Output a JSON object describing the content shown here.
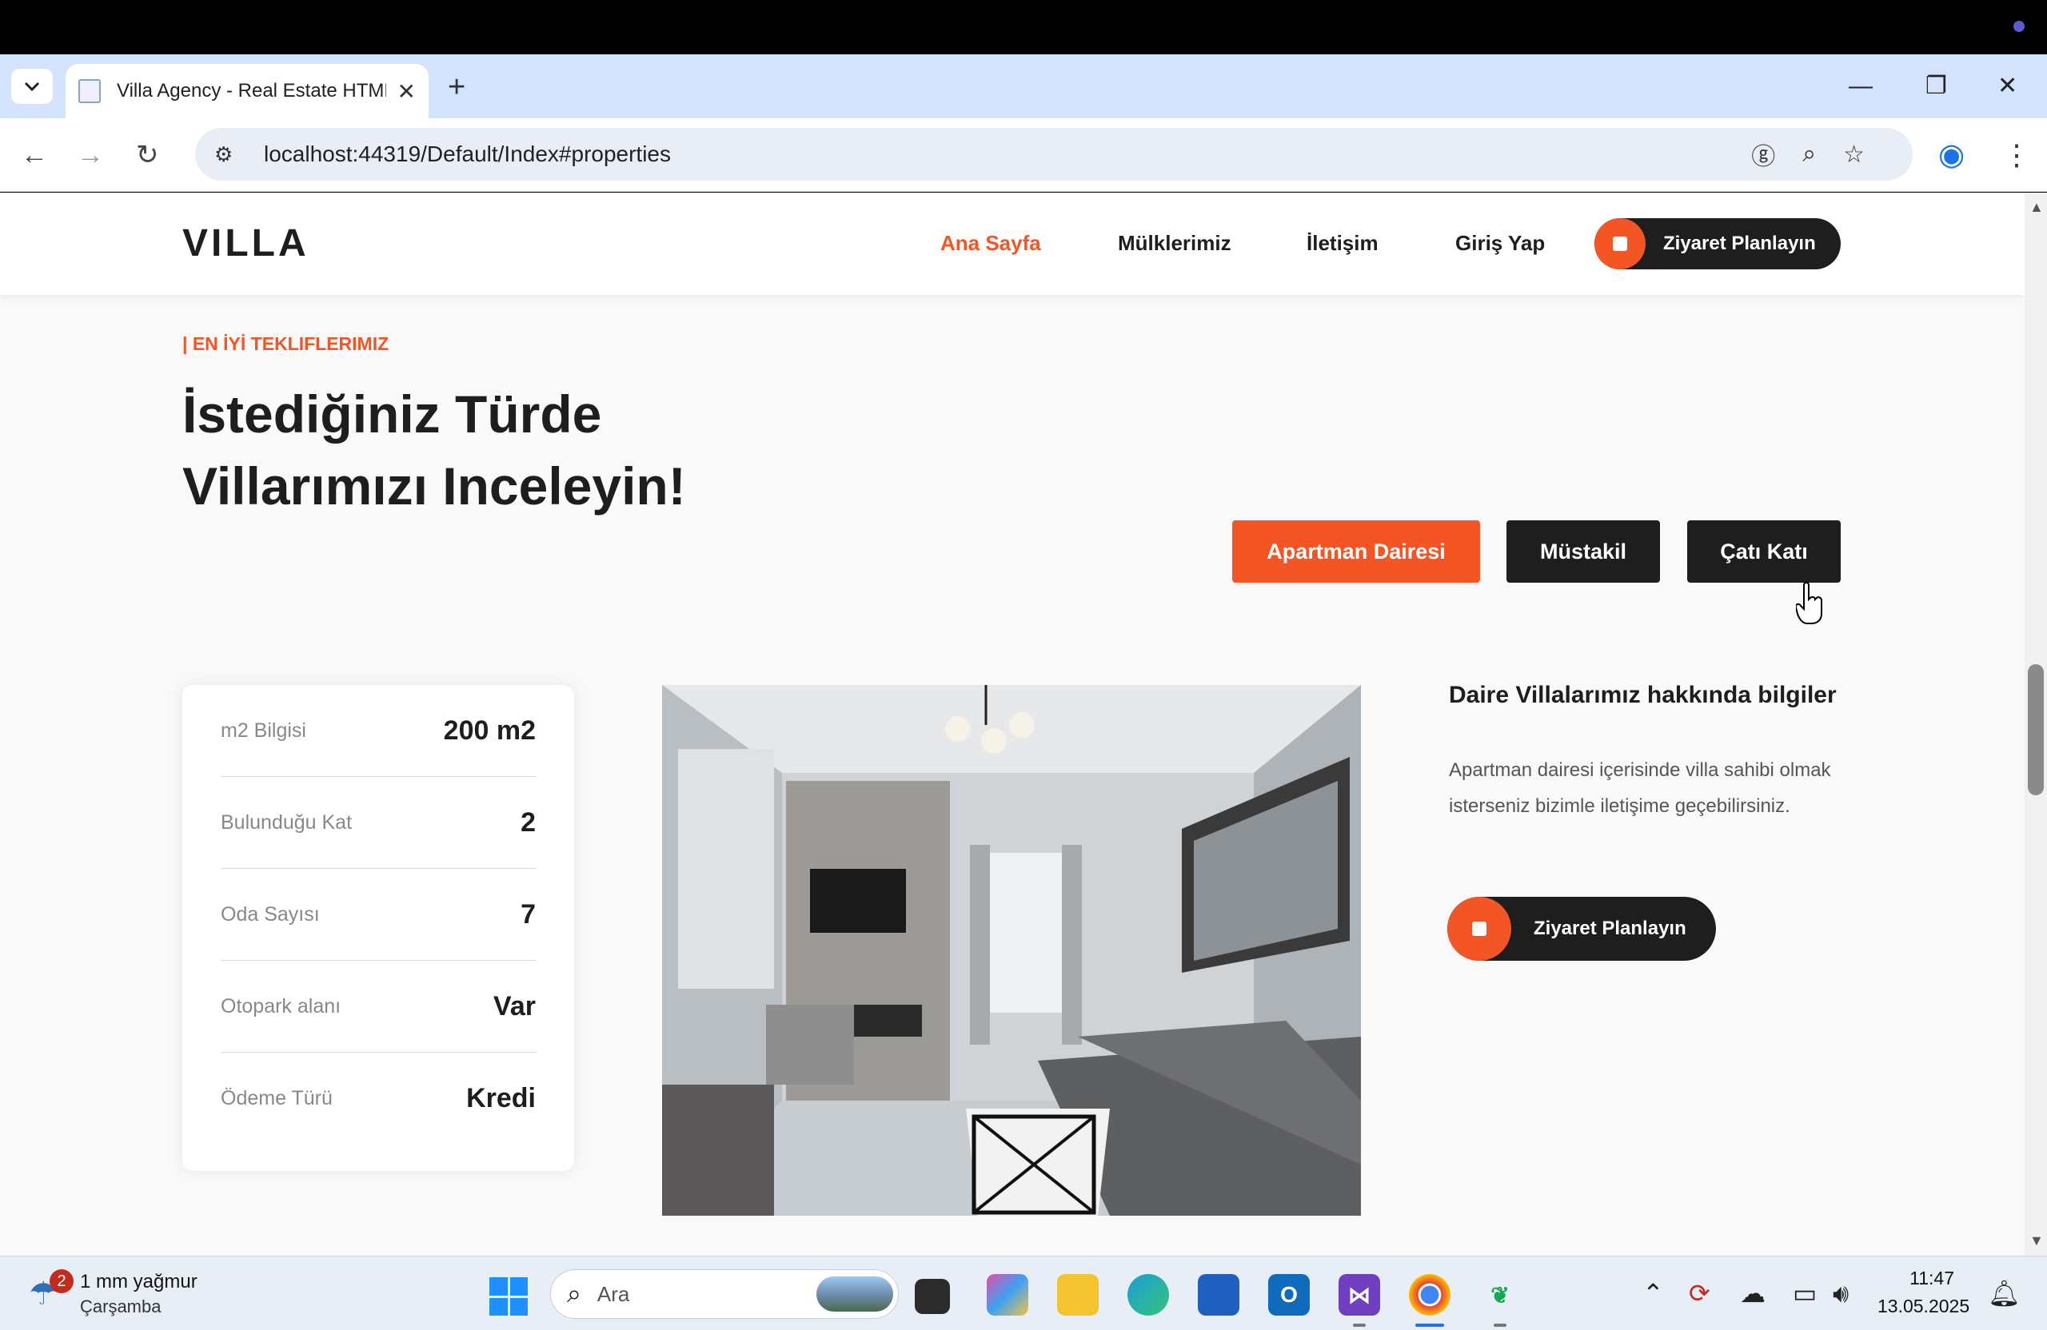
{
  "browser": {
    "tab_title": "Villa Agency - Real Estate HTML",
    "tab_close": "✕",
    "new_tab": "+",
    "url": "localhost:44319/Default/Index#properties",
    "minimize": "—",
    "restore": "❐",
    "close": "✕"
  },
  "site": {
    "logo": "VILLA",
    "nav": [
      "Ana Sayfa",
      "Mülklerimiz",
      "İletişim",
      "Giriş Yap"
    ],
    "schedule_btn": "Ziyaret Planlayın"
  },
  "section": {
    "eyebrow": "| EN İYİ TEKLIFLERIMIZ",
    "headline": "İstediğiniz Türde Villarımızı Inceleyin!",
    "filters": [
      "Apartman Dairesi",
      "Müstakil",
      "Çatı Katı"
    ]
  },
  "details": [
    {
      "label": "m2 Bilgisi",
      "value": "200 m2"
    },
    {
      "label": "Bulunduğu Kat",
      "value": "2"
    },
    {
      "label": "Oda Sayısı",
      "value": "7"
    },
    {
      "label": "Otopark alanı",
      "value": "Var"
    },
    {
      "label": "Ödeme Türü",
      "value": "Kredi"
    }
  ],
  "info": {
    "title": "Daire Villalarımız hakkında bilgiler",
    "text": "Apartman dairesi içerisinde villa sahibi olmak isterseniz bizimle iletişime geçebilirsiniz.",
    "button": "Ziyaret Planlayın"
  },
  "taskbar": {
    "weather_badge": "2",
    "weather_line1": "1 mm yağmur",
    "weather_line2": "Çarşamba",
    "search_placeholder": "Ara",
    "time": "11:47",
    "date": "13.05.2025"
  },
  "colors": {
    "accent": "#f35525",
    "dark": "#1e1e1e",
    "page_bg": "#f9f9f9"
  }
}
